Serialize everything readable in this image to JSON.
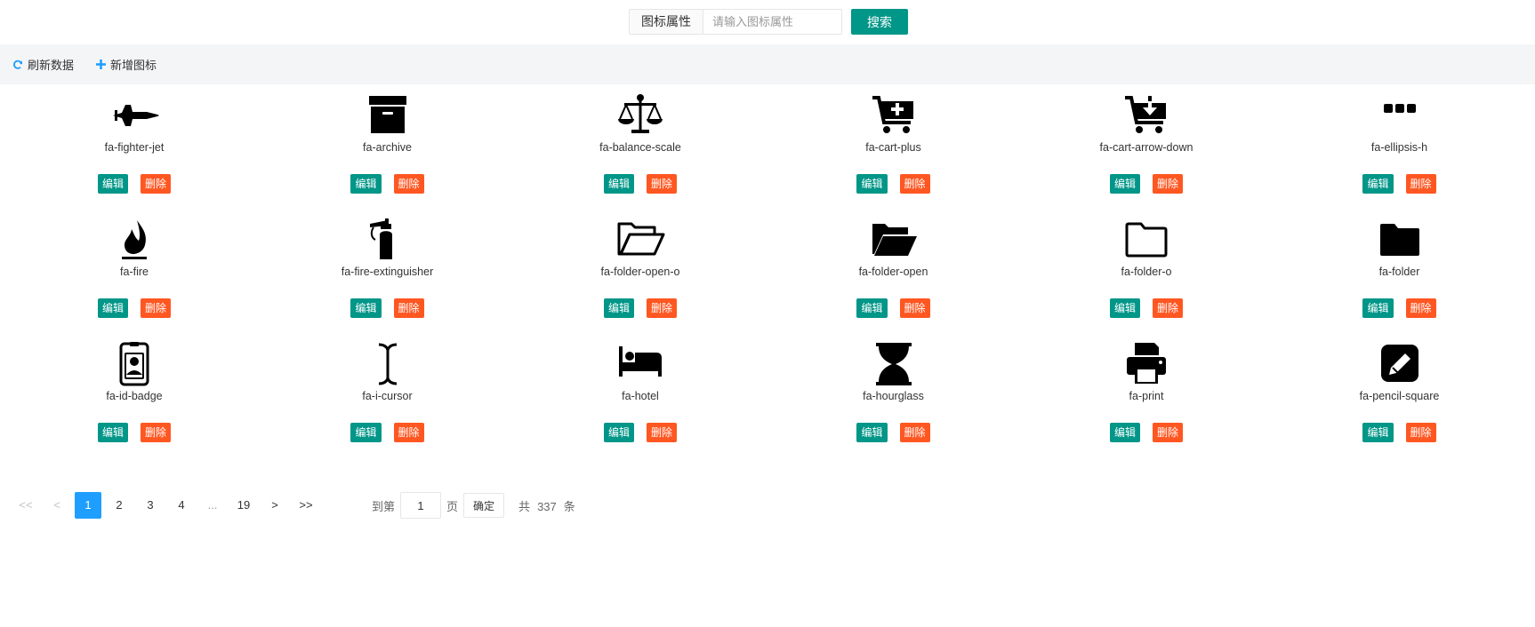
{
  "search": {
    "label": "图标属性",
    "placeholder": "请输入图标属性",
    "value": "",
    "button_label": "搜索"
  },
  "toolbar": {
    "refresh_label": "刷新数据",
    "add_label": "新增图标"
  },
  "colors": {
    "primary": "#009688",
    "danger": "#ff5722",
    "pager_active": "#1e9fff",
    "toolbar_bg": "#f4f5f7"
  },
  "grid": {
    "edit_label": "编辑",
    "delete_label": "删除",
    "items": [
      {
        "name": "fa-fighter-jet",
        "icon": "fighter-jet"
      },
      {
        "name": "fa-archive",
        "icon": "archive"
      },
      {
        "name": "fa-balance-scale",
        "icon": "balance-scale"
      },
      {
        "name": "fa-cart-plus",
        "icon": "cart-plus"
      },
      {
        "name": "fa-cart-arrow-down",
        "icon": "cart-arrow-down"
      },
      {
        "name": "fa-ellipsis-h",
        "icon": "ellipsis-h"
      },
      {
        "name": "fa-fire",
        "icon": "fire"
      },
      {
        "name": "fa-fire-extinguisher",
        "icon": "fire-extinguisher"
      },
      {
        "name": "fa-folder-open-o",
        "icon": "folder-open-o"
      },
      {
        "name": "fa-folder-open",
        "icon": "folder-open"
      },
      {
        "name": "fa-folder-o",
        "icon": "folder-o"
      },
      {
        "name": "fa-folder",
        "icon": "folder"
      },
      {
        "name": "fa-id-badge",
        "icon": "id-badge"
      },
      {
        "name": "fa-i-cursor",
        "icon": "i-cursor"
      },
      {
        "name": "fa-hotel",
        "icon": "hotel"
      },
      {
        "name": "fa-hourglass",
        "icon": "hourglass"
      },
      {
        "name": "fa-print",
        "icon": "print"
      },
      {
        "name": "fa-pencil-square",
        "icon": "pencil-square"
      }
    ]
  },
  "pagination": {
    "first": "<<",
    "prev": "<",
    "pages": [
      "1",
      "2",
      "3",
      "4"
    ],
    "current": "1",
    "ellipsis": "...",
    "last_page": "19",
    "next": ">",
    "last": ">>",
    "goto_prefix": "到第",
    "goto_value": "1",
    "goto_suffix": "页",
    "confirm_label": "确定",
    "total_prefix": "共",
    "total_count": "337",
    "total_suffix": "条"
  }
}
